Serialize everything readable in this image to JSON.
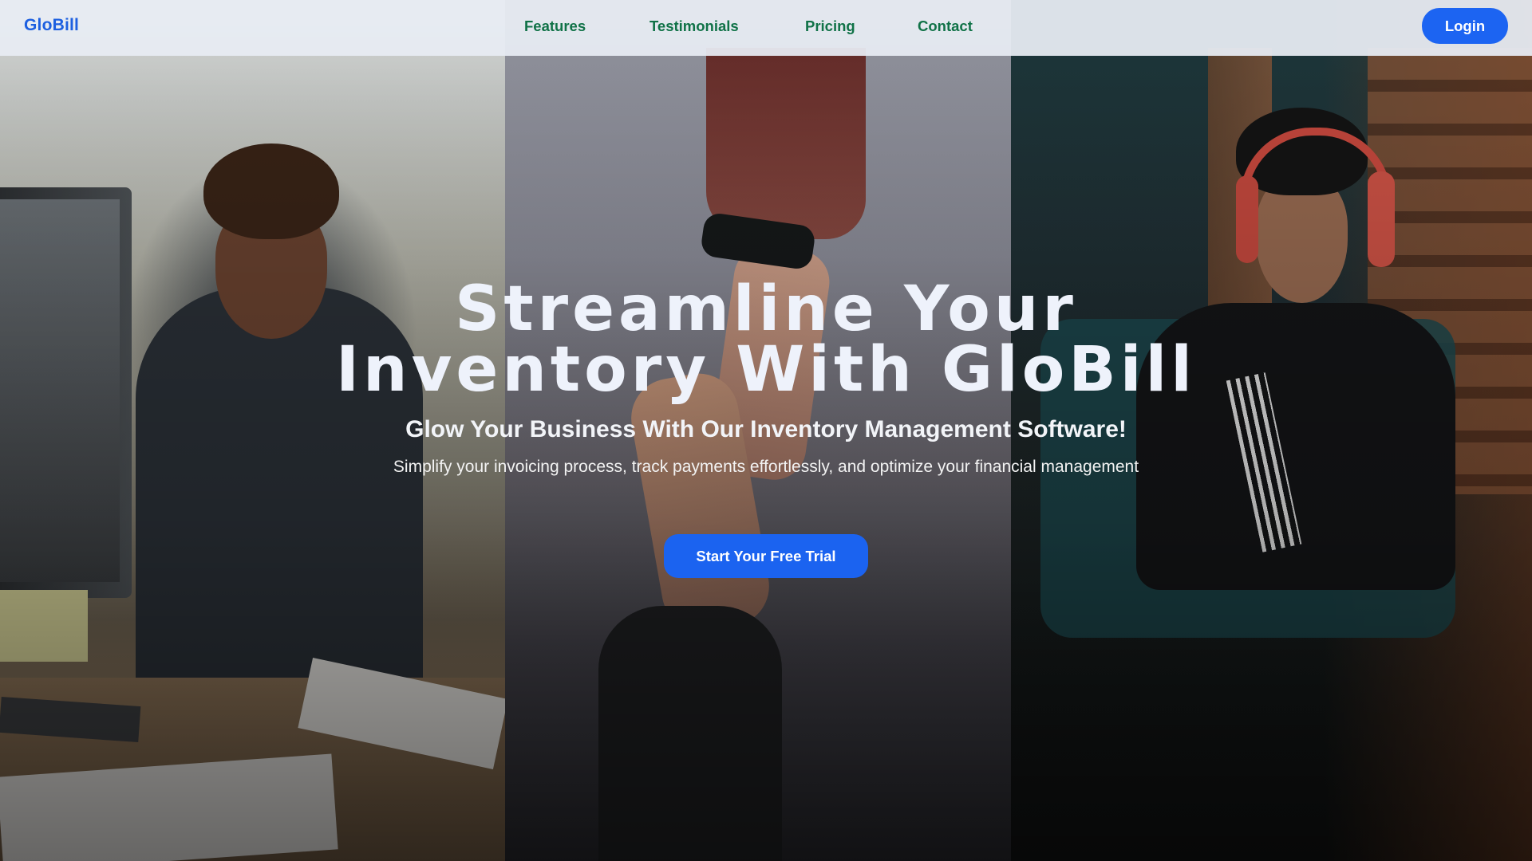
{
  "navbar": {
    "brand": "GloBill",
    "links": [
      {
        "label": "Features"
      },
      {
        "label": "Testimonials"
      },
      {
        "label": "Pricing"
      },
      {
        "label": "Contact"
      }
    ],
    "login_label": "Login"
  },
  "hero": {
    "title_line1": "Streamline Your",
    "title_line2": "Inventory With GloBill",
    "subtitle": "Glow Your Business With Our Inventory Management Software!",
    "description": "Simplify your invoicing process, track payments effortlessly, and optimize your financial management",
    "cta_label": "Start Your Free Trial"
  },
  "colors": {
    "brand": "#1d5fe0",
    "nav_link": "#107247",
    "primary_button": "#1c64f2",
    "navbar_bg": "#e8ecf3"
  }
}
